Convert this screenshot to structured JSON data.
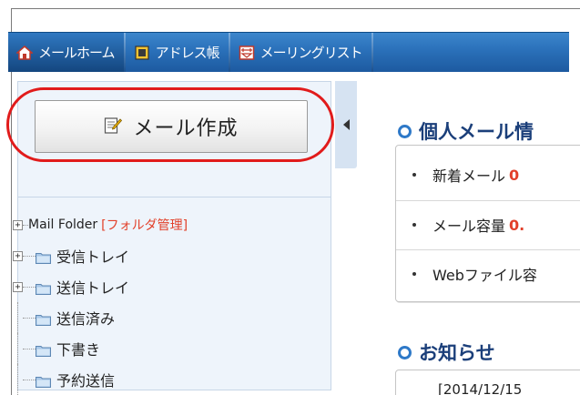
{
  "nav": {
    "items": [
      {
        "label": "メールホーム",
        "icon": "house-icon"
      },
      {
        "label": "アドレス帳",
        "icon": "address-book-icon"
      },
      {
        "label": "メーリングリスト",
        "icon": "mailing-list-icon"
      }
    ]
  },
  "sidebar": {
    "compose_label": "メール作成",
    "folders": [
      {
        "label": "Mail Folder",
        "extra": "[フォルダ管理]",
        "expander": "+"
      },
      {
        "label": "受信トレイ",
        "expander": "+"
      },
      {
        "label": "送信トレイ",
        "expander": "+"
      },
      {
        "label": "送信済み",
        "expander": ""
      },
      {
        "label": "下書き",
        "expander": ""
      },
      {
        "label": "予約送信",
        "expander": ""
      }
    ]
  },
  "main": {
    "personal_title": "個人メール情",
    "info_rows": [
      {
        "label": "新着メール",
        "value": "0"
      },
      {
        "label": "メール容量",
        "value": "0."
      },
      {
        "label": "Webファイル容",
        "value": ""
      }
    ],
    "news_title": "お知らせ",
    "news_first": "[2014/12/15"
  },
  "colors": {
    "nav_bg": "#2a70b9",
    "accent_red": "#e2402a",
    "highlight": "#e11b1b",
    "title_blue": "#1b3f7a"
  }
}
